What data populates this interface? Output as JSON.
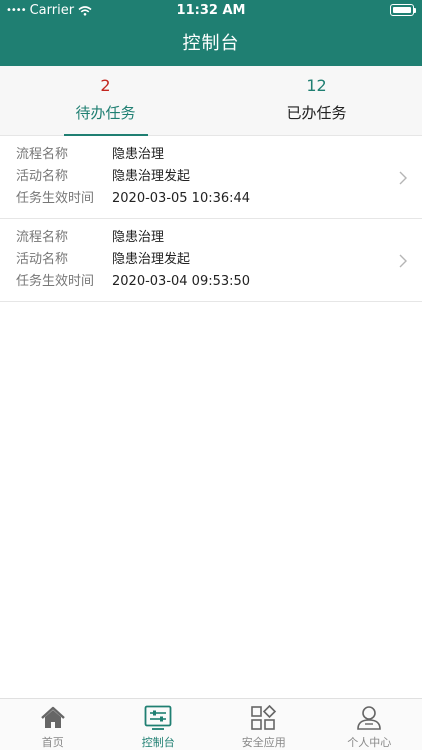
{
  "status_bar": {
    "carrier": "Carrier",
    "time": "11:32 AM"
  },
  "header": {
    "title": "控制台"
  },
  "tabs": [
    {
      "count": "2",
      "label": "待办任务"
    },
    {
      "count": "12",
      "label": "已办任务"
    }
  ],
  "tasks": [
    {
      "flow_label": "流程名称",
      "flow_value": "隐患治理",
      "activity_label": "活动名称",
      "activity_value": "隐患治理发起",
      "time_label": "任务生效时间",
      "time_value": "2020-03-05 10:36:44"
    },
    {
      "flow_label": "流程名称",
      "flow_value": "隐患治理",
      "activity_label": "活动名称",
      "activity_value": "隐患治理发起",
      "time_label": "任务生效时间",
      "time_value": "2020-03-04 09:53:50"
    }
  ],
  "tabbar": {
    "items": [
      {
        "label": "首页",
        "icon": "home-icon"
      },
      {
        "label": "控制台",
        "icon": "console-icon"
      },
      {
        "label": "安全应用",
        "icon": "apps-icon"
      },
      {
        "label": "个人中心",
        "icon": "user-icon"
      }
    ]
  },
  "colors": {
    "primary": "#1f7f72",
    "badge_red": "#c3261f"
  }
}
